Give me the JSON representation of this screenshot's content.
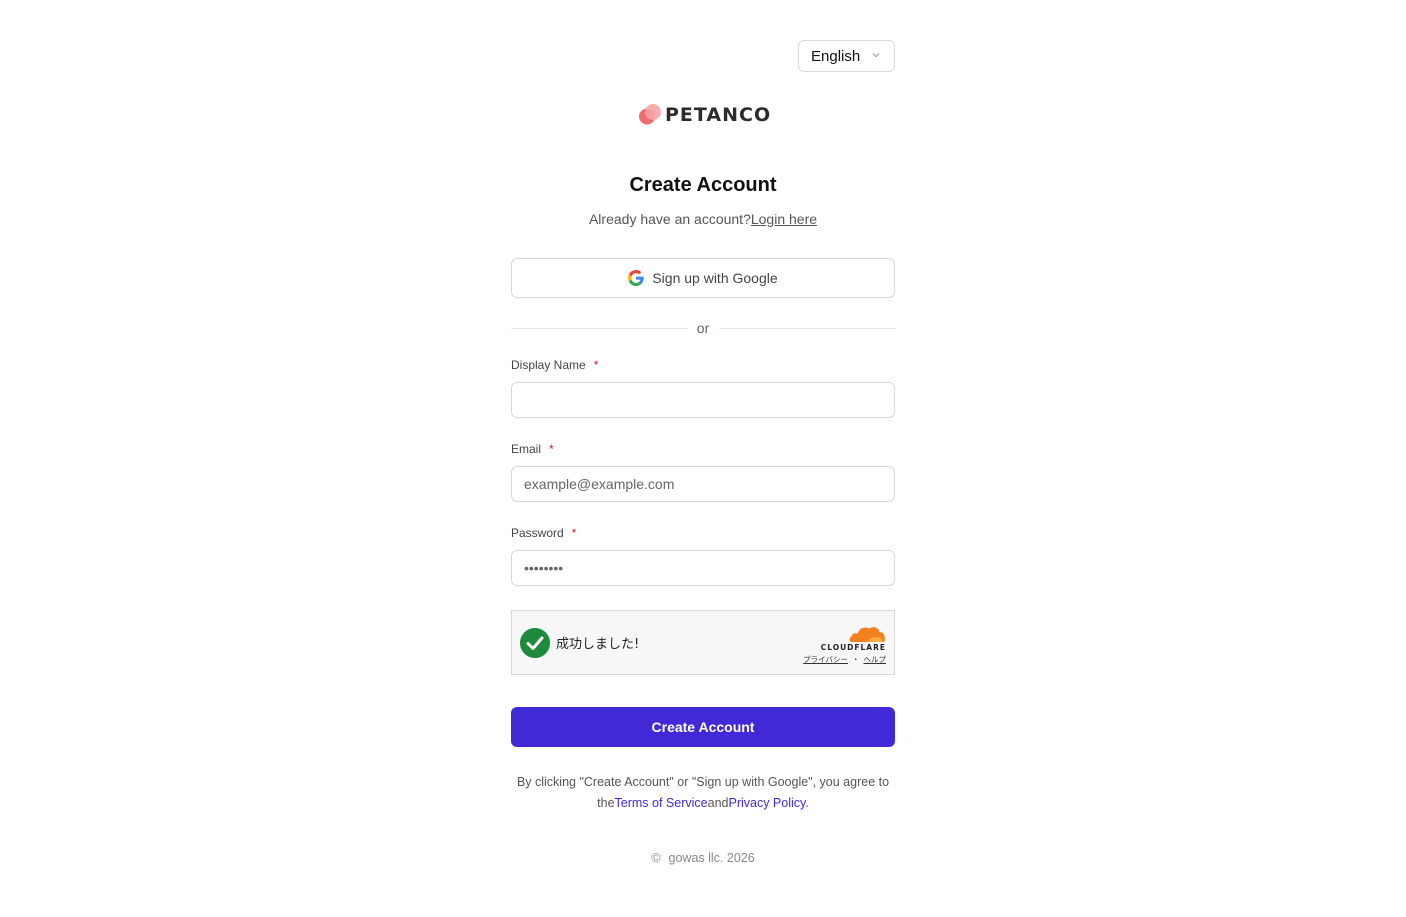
{
  "language_selector": {
    "value": "English"
  },
  "brand": {
    "name": "PETANCO",
    "colors": {
      "primary": "#f26d6d",
      "secondary": "#f7a5a5"
    }
  },
  "form": {
    "title": "Create Account",
    "login_prompt": "Already have an account?",
    "login_link": "Login here",
    "google_button": "Sign up with Google",
    "divider": "or",
    "fields": {
      "display_name": {
        "label": "Display Name",
        "required_mark": "*",
        "value": "",
        "placeholder": ""
      },
      "email": {
        "label": "Email",
        "required_mark": "*",
        "value": "",
        "placeholder": "example@example.com"
      },
      "password": {
        "label": "Password",
        "required_mark": "*",
        "value": "",
        "placeholder": "••••••••"
      }
    },
    "captcha": {
      "status": "成功しました!",
      "provider": "CLOUDFLARE",
      "privacy_link": "プライバシー",
      "separator": "・",
      "help_link": "ヘルプ",
      "colors": {
        "success": "#1f8a3c",
        "cloud": "#f48120"
      }
    },
    "submit_button": "Create Account",
    "legal": {
      "text_before": "By clicking \"Create Account\" or \"Sign up with Google\", you agree to the",
      "terms_link": "Terms of Service",
      "and": "and",
      "privacy_link": "Privacy Policy",
      "end": "."
    },
    "accent_color": "#4129d8"
  },
  "footer": {
    "copyright_symbol": "©",
    "text": "gowas llc. 2026"
  }
}
